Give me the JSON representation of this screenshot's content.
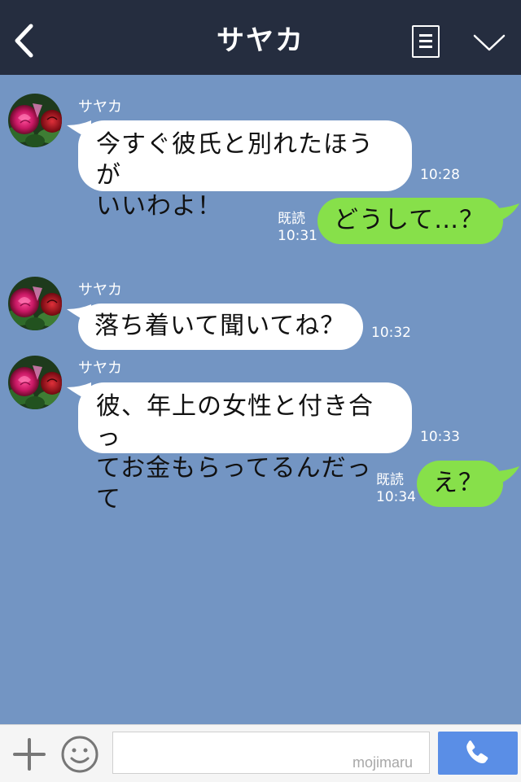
{
  "header": {
    "title": "サヤカ",
    "back_icon": "chevron-left-icon",
    "menu_icon": "list-menu-icon",
    "collapse_icon": "chevron-down-icon"
  },
  "messages": [
    {
      "sender": "サヤカ",
      "text": "今すぐ彼氏と別れたほうが\nいいわよ！",
      "time": "10:28"
    },
    {
      "sender": "me",
      "text": "どうして…？",
      "read": "既読",
      "time": "10:31"
    },
    {
      "sender": "サヤカ",
      "text": "落ち着いて聞いてね？",
      "time": "10:32"
    },
    {
      "sender": "サヤカ",
      "text": "彼、年上の女性と付き合っ\nてお金もらってるんだって",
      "time": "10:33"
    },
    {
      "sender": "me",
      "text": "え？",
      "read": "既読",
      "time": "10:34"
    }
  ],
  "footer": {
    "input_value": "",
    "watermark": "mojimaru",
    "plus_icon": "plus-icon",
    "emoji_icon": "smiley-icon",
    "call_icon": "phone-icon"
  },
  "colors": {
    "header_bg": "#252d3f",
    "chat_bg": "#7395c3",
    "my_bubble": "#87e04a",
    "their_bubble": "#ffffff",
    "call_button": "#5a8ee6"
  }
}
